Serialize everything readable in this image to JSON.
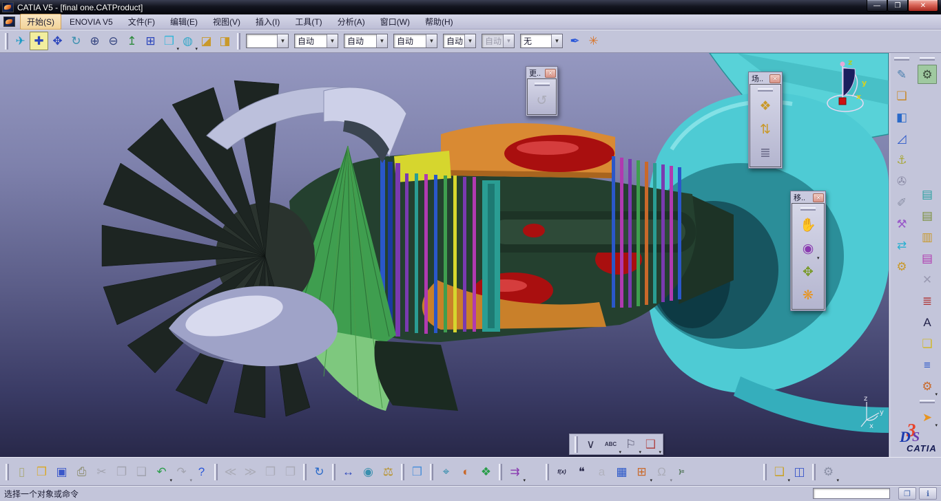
{
  "window": {
    "title": "CATIA V5 - [final one.CATProduct]",
    "controls": {
      "minimize": "—",
      "restore": "❐",
      "close": "✕"
    }
  },
  "menu": {
    "items": [
      {
        "label": "开始(S)"
      },
      {
        "label": "ENOVIA V5"
      },
      {
        "label": "文件(F)"
      },
      {
        "label": "编辑(E)"
      },
      {
        "label": "视图(V)"
      },
      {
        "label": "插入(I)"
      },
      {
        "label": "工具(T)"
      },
      {
        "label": "分析(A)"
      },
      {
        "label": "窗口(W)"
      },
      {
        "label": "帮助(H)"
      }
    ]
  },
  "view_toolbar": {
    "icons": [
      {
        "handle": true
      },
      {
        "name": "fly-mode-icon",
        "glyph": "✈",
        "color": "#1899c4"
      },
      {
        "name": "fit-all-icon",
        "glyph": "✚",
        "color": "#2a44bb",
        "bg": "#f2ee9e",
        "border": "#8a8a5a"
      },
      {
        "name": "pan-icon",
        "glyph": "✥",
        "color": "#2a44bb"
      },
      {
        "name": "rotate-icon",
        "glyph": "↻",
        "color": "#3a8fae"
      },
      {
        "name": "zoom-in-icon",
        "glyph": "⊕",
        "color": "#33437f"
      },
      {
        "name": "zoom-out-icon",
        "glyph": "⊖",
        "color": "#33437f"
      },
      {
        "name": "normal-view-icon",
        "glyph": "↥",
        "color": "#2a8a3a"
      },
      {
        "name": "multi-view-icon",
        "glyph": "⊞",
        "color": "#2a44bb"
      },
      {
        "name": "iso-view-icon",
        "glyph": "❒",
        "color": "#36b6d8",
        "caret": true
      },
      {
        "name": "render-style-icon",
        "glyph": "◍",
        "color": "#36a8c8",
        "caret": true
      },
      {
        "name": "hide-show-icon",
        "glyph": "◪",
        "color": "#c9992a"
      },
      {
        "name": "swap-visible-space-icon",
        "glyph": "◨",
        "color": "#c9992a"
      },
      {
        "handle": true
      }
    ],
    "combos": [
      {
        "name": "graphic-color-combo",
        "value": ""
      },
      {
        "name": "opacity-combo",
        "value": "自动"
      },
      {
        "name": "line-weight-combo",
        "value": "自动"
      },
      {
        "name": "line-type-combo",
        "value": "自动"
      },
      {
        "name": "point-symbol-combo",
        "value": "自动"
      },
      {
        "name": "render-mode-combo",
        "value": "自动"
      },
      {
        "name": "layer-combo",
        "value": "无"
      }
    ],
    "tail_icons": [
      {
        "name": "copy-graphic-properties-icon",
        "glyph": "✒",
        "color": "#2a57d9"
      },
      {
        "name": "wizard-icon",
        "glyph": "✳",
        "color": "#d9752a"
      }
    ]
  },
  "floating": {
    "update": {
      "title": "更..",
      "close_glyph": "✕",
      "icons": [
        {
          "name": "update-icon",
          "glyph": "↺",
          "color": "#8a8aa5",
          "disabled": true,
          "big": true
        }
      ]
    },
    "scene": {
      "title": "场..",
      "close_glyph": "✕",
      "icons": [
        {
          "handle": true
        },
        {
          "name": "enhanced-scene-icon",
          "glyph": "❖",
          "color": "#c9992a"
        },
        {
          "name": "apply-scene-icon",
          "glyph": "⇅",
          "color": "#c9992a"
        },
        {
          "name": "scene-browser-icon",
          "glyph": "≣",
          "color": "#6a6a88"
        }
      ]
    },
    "move": {
      "title": "移..",
      "close_glyph": "✕",
      "icons": [
        {
          "handle": true
        },
        {
          "name": "manipulate-icon",
          "glyph": "✋",
          "color": "#d9892a"
        },
        {
          "name": "snap-icon",
          "glyph": "◉",
          "color": "#8a3ab0",
          "caret": true
        },
        {
          "name": "explode-icon",
          "glyph": "✥",
          "color": "#7a9a2a"
        },
        {
          "name": "clash-stop-manipulate-icon",
          "glyph": "❋",
          "color": "#e8941f"
        }
      ]
    }
  },
  "sidebar": {
    "col1": [
      {
        "handle": true
      },
      {
        "name": "dmu-review-pen-icon",
        "glyph": "✎",
        "color": "#4a7fae"
      },
      {
        "name": "sectioning-box-icon",
        "glyph": "❏",
        "color": "#c9892a"
      },
      {
        "name": "distance-band-icon",
        "glyph": "◧",
        "color": "#2a6ac9"
      },
      {
        "name": "measure-setsquare-icon",
        "glyph": "◿",
        "color": "#2a57c9"
      },
      {
        "name": "anchor-icon",
        "glyph": "⚓",
        "color": "#a8a83a"
      },
      {
        "name": "attach-clip-icon",
        "glyph": "✇",
        "color": "#8a8aa5"
      },
      {
        "name": "marker-pen-icon",
        "glyph": "✐",
        "color": "#8a8fa5"
      },
      {
        "name": "fasteners-icon",
        "glyph": "⚒",
        "color": "#9a5ac9"
      },
      {
        "name": "swap-update-arrows-icon",
        "glyph": "⇄",
        "color": "#2ab0d0"
      },
      {
        "name": "update-gears-icon",
        "glyph": "⚙",
        "color": "#c9992a"
      }
    ],
    "col2": [
      {
        "handle": true
      },
      {
        "name": "applications-gears-icon",
        "glyph": "⚙",
        "color": "#3a4a3a",
        "bg": "#9fc9a0",
        "border": "#6a8a6a"
      },
      {
        "gap": 140
      },
      {
        "name": "new-from-document-icon",
        "glyph": "▤",
        "color": "#2aa0a0"
      },
      {
        "name": "generate-report-icon",
        "glyph": "▤",
        "color": "#7a8f3a"
      },
      {
        "name": "export-document-icon",
        "glyph": "▥",
        "color": "#c9992a"
      },
      {
        "name": "import-document-icon",
        "glyph": "▤",
        "color": "#b03ab0"
      },
      {
        "name": "broken-links-icon",
        "glyph": "✕",
        "color": "#9a9ab2"
      },
      {
        "name": "reorder-tree-icon",
        "glyph": "≣",
        "color": "#b03a3a"
      },
      {
        "name": "text-annotation-icon",
        "glyph": "A",
        "color": "#22224a"
      },
      {
        "name": "window-layout-icon",
        "glyph": "❏",
        "color": "#d0b82a"
      },
      {
        "name": "product-structure-icon",
        "glyph": "≡",
        "color": "#2a57c9"
      },
      {
        "name": "knowledge-gear-n-icon",
        "glyph": "⚙",
        "color": "#c9692a",
        "caret": true
      },
      {
        "handle": true
      },
      {
        "name": "select-cursor-icon",
        "glyph": "➤",
        "color": "#e8941f",
        "caret": true
      }
    ]
  },
  "annotation_toolbar": {
    "icons": [
      {
        "handle": true
      },
      {
        "name": "weld-symbol-icon",
        "glyph": "∨",
        "color": "#33334f"
      },
      {
        "name": "text-leader-icon",
        "glyph": "ABC",
        "color": "#33334f",
        "small": true,
        "caret": true
      },
      {
        "name": "flag-note-icon",
        "glyph": "⚐",
        "color": "#55556f",
        "caret": true
      },
      {
        "name": "annotation-3d-icon",
        "glyph": "❑",
        "color": "#b04a4a",
        "caret": true
      }
    ]
  },
  "standard_toolbar": {
    "icons": [
      {
        "handle": true
      },
      {
        "name": "new-document-icon",
        "glyph": "▯",
        "color": "#a8a878"
      },
      {
        "name": "open-folder-icon",
        "glyph": "❒",
        "color": "#d9a92a"
      },
      {
        "name": "save-icon",
        "glyph": "▣",
        "color": "#3a57c9"
      },
      {
        "name": "print-icon",
        "glyph": "⎙",
        "color": "#8a8a6a"
      },
      {
        "name": "cut-icon",
        "glyph": "✂",
        "color": "#777777",
        "disabled": true
      },
      {
        "name": "copy-icon",
        "glyph": "❐",
        "color": "#777777",
        "disabled": true
      },
      {
        "name": "paste-icon",
        "glyph": "❑",
        "color": "#777777",
        "disabled": true
      },
      {
        "name": "undo-icon",
        "glyph": "↶",
        "color": "#2a9d4a",
        "caret": true
      },
      {
        "name": "redo-icon",
        "glyph": "↷",
        "color": "#777777",
        "disabled": true,
        "caret": true
      },
      {
        "name": "whats-this-icon",
        "glyph": "?",
        "color": "#2a57d9"
      },
      {
        "handle": true
      },
      {
        "name": "fly-back-icon",
        "glyph": "≪",
        "color": "#888888",
        "disabled": true
      },
      {
        "name": "fly-forward-icon",
        "glyph": "≫",
        "color": "#888888",
        "disabled": true
      },
      {
        "name": "camera-prev-icon",
        "glyph": "❐",
        "color": "#888888",
        "disabled": true
      },
      {
        "name": "camera-next-icon",
        "glyph": "❐",
        "color": "#888888",
        "disabled": true
      },
      {
        "handle": true
      },
      {
        "name": "turntable-icon",
        "glyph": "↻",
        "color": "#2a6ac9"
      },
      {
        "handle": true
      },
      {
        "name": "measure-between-icon",
        "glyph": "↔",
        "color": "#2a44bb"
      },
      {
        "name": "measure-item-icon",
        "glyph": "◉",
        "color": "#3a8fae"
      },
      {
        "name": "measure-inertia-icon",
        "glyph": "⚖",
        "color": "#b8922a"
      },
      {
        "handle": true
      },
      {
        "name": "clash-analysis-icon",
        "glyph": "❒",
        "color": "#4a8fd9"
      },
      {
        "handle": true
      },
      {
        "name": "enhanced-scene-bottom-icon",
        "glyph": "⌖",
        "color": "#3a8fae"
      },
      {
        "name": "render-sphere-icon",
        "glyph": "◐",
        "color": "#c9692a"
      },
      {
        "name": "apply-material-icon",
        "glyph": "❖",
        "color": "#2a9d4a"
      },
      {
        "handle": true
      },
      {
        "name": "snap-grid-icon",
        "glyph": "⇉",
        "color": "#8a3ab0",
        "caret": true
      },
      {
        "gap": 26
      },
      {
        "handle": true
      },
      {
        "name": "formula-icon",
        "glyph": "f(x)",
        "color": "#1a1a3a",
        "small": true,
        "italic": true
      },
      {
        "name": "comment-icon",
        "glyph": "❝",
        "color": "#2a2a4a"
      },
      {
        "name": "catalog-icon",
        "glyph": "a",
        "color": "#999999",
        "disabled": true
      },
      {
        "name": "design-table-icon",
        "glyph": "▦",
        "color": "#2a57c9"
      },
      {
        "name": "product-knowledge-icon",
        "glyph": "⊞",
        "color": "#c9692a",
        "caret": true
      },
      {
        "name": "lock-icon",
        "glyph": "Ω",
        "color": "#8a8a8a",
        "disabled": true,
        "caret": true
      },
      {
        "name": "equivalent-dimensions-icon",
        "glyph": "}=",
        "color": "#2a5a2a",
        "small": true
      },
      {
        "gap": 100
      },
      {
        "handle": true
      },
      {
        "name": "publication-key-icon",
        "glyph": "❑",
        "color": "#c9a22a",
        "caret": true
      },
      {
        "name": "hide-show-swap-icon",
        "glyph": "◫",
        "color": "#3a57c9"
      },
      {
        "handle": true
      },
      {
        "name": "knowledge-inspector-icon",
        "glyph": "⚙",
        "color": "#8a8fa5",
        "caret": true
      }
    ]
  },
  "status_bar": {
    "message": "选择一个对象或命令",
    "command_field_value": "",
    "buttons": [
      {
        "name": "doc-window-button",
        "glyph": "❐",
        "color": "#4a6aae"
      },
      {
        "name": "knowledge-info-button",
        "glyph": "ℹ",
        "color": "#4a6aae"
      }
    ]
  },
  "logo": {
    "d3": "3",
    "d": "D",
    "s": "S",
    "catia": "CATIA"
  },
  "compass_labels": {
    "x": "x",
    "y": "y",
    "z": "z"
  },
  "triad_labels": {
    "x": "x",
    "y": "y",
    "z": "z"
  },
  "colors": {
    "chrome": "#c3c5da",
    "viewport_top": "#9598c0",
    "viewport_bottom": "#282849",
    "nozzle_cyan": "#4ecbd4",
    "core_green": "#24402f",
    "combustor_red": "#a90f0f",
    "casing_orange": "#d98a33"
  }
}
